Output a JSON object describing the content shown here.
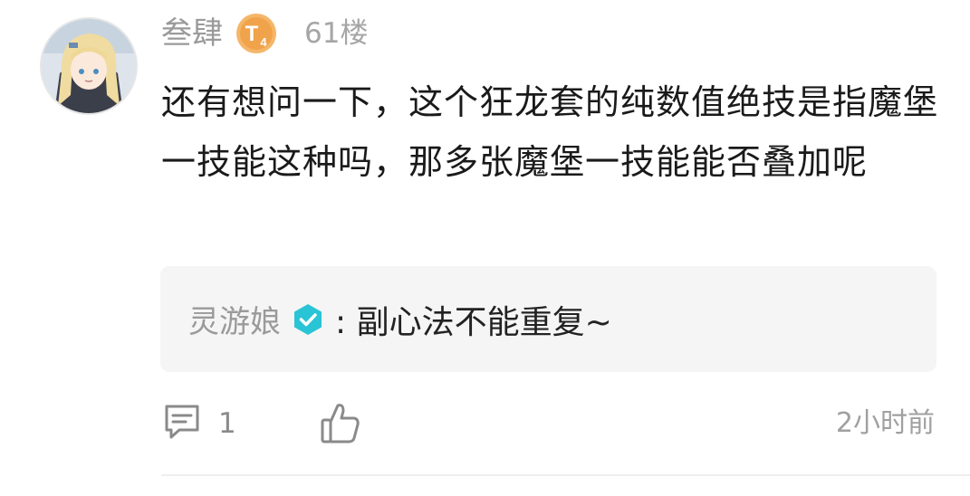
{
  "comment": {
    "username": "叁肆",
    "level_badge": {
      "letter": "T",
      "sub": "4",
      "color": "#f0a34a"
    },
    "floor": "61楼",
    "text": "还有想问一下，这个狂龙套的纯数值绝技是指魔堡一技能这种吗，那多张魔堡一技能能否叠加呢"
  },
  "reply": {
    "author": "灵游娘",
    "verified_color": "#29c4d6",
    "text": ": 副心法不能重复~"
  },
  "actions": {
    "reply_icon": "comment-icon",
    "reply_count": "1",
    "like_icon": "thumbs-up-icon",
    "timestamp": "2小时前"
  }
}
